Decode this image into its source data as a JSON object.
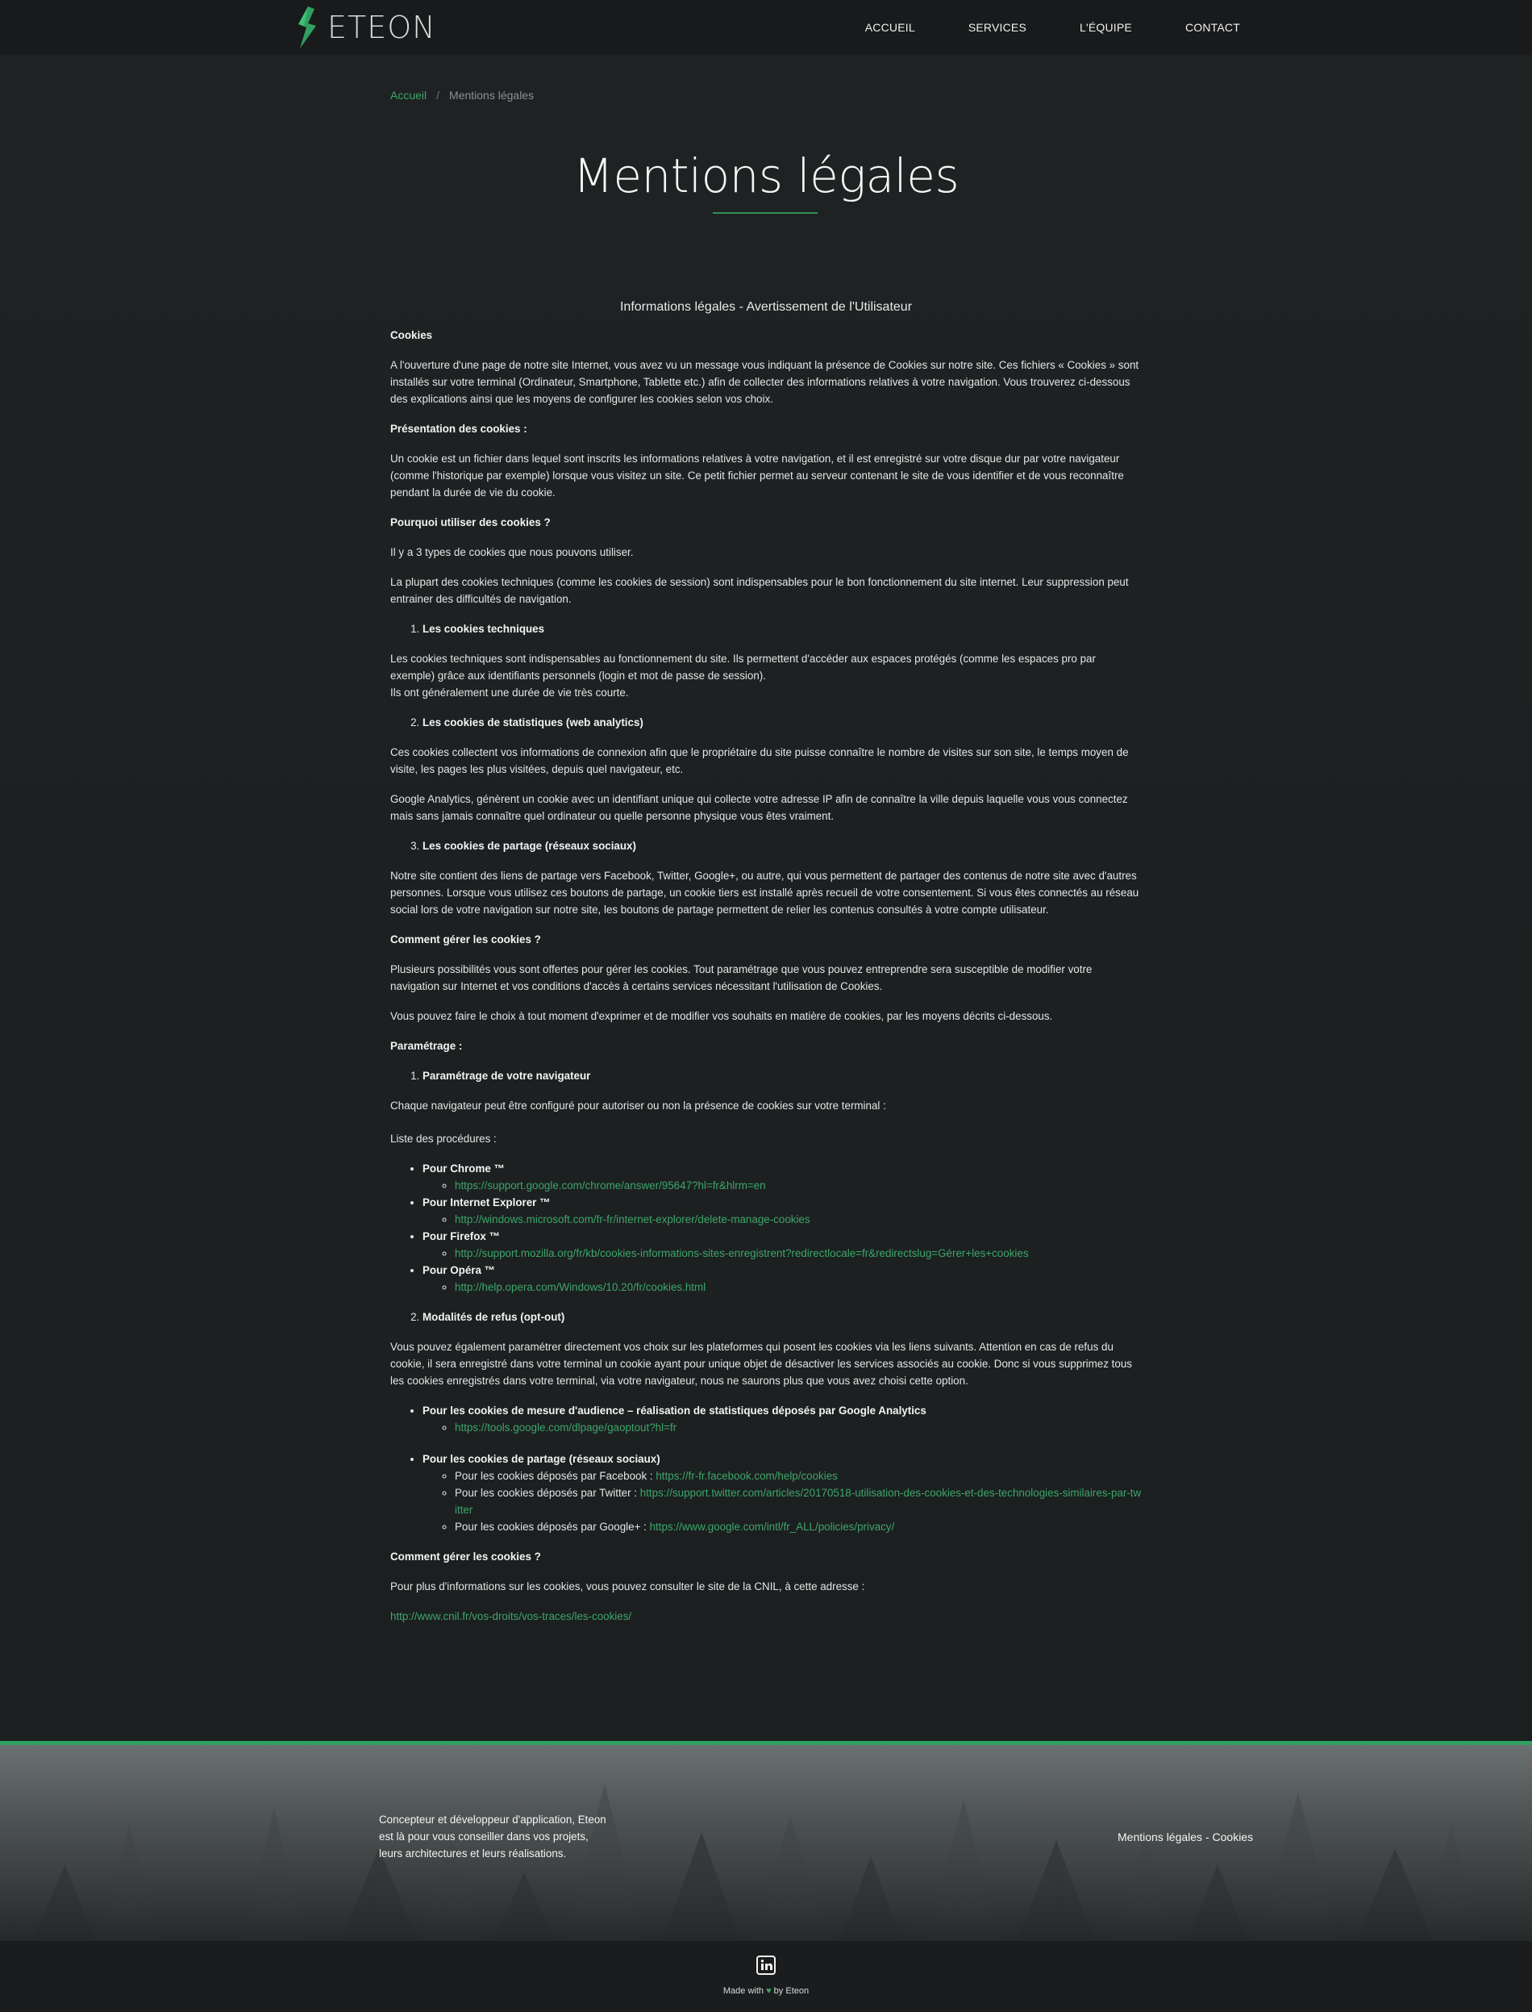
{
  "header": {
    "brand": "ETEON",
    "nav": [
      "ACCUEIL",
      "SERVICES",
      "L'ÉQUIPE",
      "CONTACT"
    ]
  },
  "breadcrumb": {
    "home": "Accueil",
    "separator": "/",
    "current": "Mentions légales"
  },
  "page": {
    "title": "Mentions légales"
  },
  "content": {
    "subtitle": "Informations légales - Avertissement de l'Utilisateur",
    "cookies_heading": "Cookies",
    "intro": "A l'ouverture d'une page de notre site Internet, vous avez vu un message vous indiquant la présence de Cookies sur notre site. Ces fichiers « Cookies » sont installés sur votre terminal (Ordinateur, Smartphone, Tablette etc.) afin de collecter des informations relatives à votre navigation. Vous trouverez ci-dessous des explications ainsi que les moyens de configurer les cookies selon vos choix.",
    "presentation_heading": "Présentation des cookies :",
    "presentation_text": "Un cookie est un fichier dans lequel sont inscrits les informations relatives à votre navigation, et il est enregistré sur votre disque dur par votre navigateur (comme l'historique par exemple) lorsque vous visitez un site. Ce petit fichier permet au serveur contenant le site de vous identifier et de vous reconnaître pendant la durée de vie du cookie.",
    "why_heading": "Pourquoi utiliser des cookies ?",
    "why_text1": "Il y a 3 types de cookies que nous pouvons utiliser.",
    "why_text2": "La plupart des cookies techniques (comme les cookies de session) sont indispensables pour le bon fonctionnement du site internet. Leur suppression peut entrainer des difficultés de navigation.",
    "type1_title": "Les cookies techniques",
    "type1_text_a": "Les cookies techniques sont indispensables au fonctionnement du site. Ils permettent d'accéder aux espaces protégés (comme les espaces pro par exemple) grâce aux identifiants personnels (login et mot de passe de session).",
    "type1_text_b": "Ils ont généralement une durée de vie très courte.",
    "type2_title": "Les cookies de statistiques (web analytics)",
    "type2_text1": "Ces cookies collectent vos informations de connexion afin que le propriétaire du site puisse connaître le nombre de visites sur son site, le temps moyen de visite, les pages les plus visitées, depuis quel navigateur, etc.",
    "type2_text2": "Google Analytics, génèrent un cookie avec un identifiant unique qui collecte votre adresse IP afin de connaître la ville depuis laquelle vous vous connectez mais sans jamais connaître quel ordinateur ou quelle personne physique vous êtes vraiment.",
    "type3_title": "Les cookies de partage (réseaux sociaux)",
    "type3_text": "Notre site contient des liens de partage vers Facebook, Twitter, Google+, ou autre, qui vous permettent de partager des contenus de notre site avec d'autres personnes. Lorsque vous utilisez ces boutons de partage, un cookie tiers est installé après recueil de votre consentement. Si vous êtes connectés au réseau social lors de votre navigation sur notre site, les boutons de partage permettent de relier les contenus consultés à votre compte utilisateur.",
    "manage_heading": "Comment gérer les cookies ?",
    "manage_text1": "Plusieurs possibilités vous sont offertes pour gérer les cookies. Tout paramétrage que vous pouvez entreprendre sera susceptible de modifier votre navigation sur Internet et vos conditions d'accès à certains services nécessitant l'utilisation de Cookies.",
    "manage_text2": "Vous pouvez faire le choix à tout moment d'exprimer et de modifier vos souhaits en matière de cookies, par les moyens décrits ci-dessous.",
    "settings_heading": "Paramétrage :",
    "browser_title": "Paramétrage de votre navigateur",
    "browser_text": "Chaque navigateur peut être configuré pour autoriser ou non la présence de cookies sur votre terminal :",
    "procedures_label": "Liste des procédures :",
    "browsers": [
      {
        "name": "Pour Chrome ™",
        "url": "https://support.google.com/chrome/answer/95647?hl=fr&hlrm=en"
      },
      {
        "name": "Pour Internet Explorer ™",
        "url": "http://windows.microsoft.com/fr-fr/internet-explorer/delete-manage-cookies"
      },
      {
        "name": "Pour Firefox ™",
        "url": "http://support.mozilla.org/fr/kb/cookies-informations-sites-enregistrent?redirectlocale=fr&redirectslug=Gérer+les+cookies"
      },
      {
        "name": "Pour Opéra ™",
        "url": "http://help.opera.com/Windows/10.20/fr/cookies.html"
      }
    ],
    "optout_title": "Modalités de refus (opt-out)",
    "optout_text": "Vous pouvez également paramétrer directement vos choix sur les plateformes qui posent les cookies via les liens suivants. Attention en cas de refus du cookie, il sera enregistré dans votre terminal un cookie ayant pour unique objet de désactiver les services associés au cookie. Donc si vous supprimez tous les cookies enregistrés dans votre terminal, via votre navigateur, nous ne saurons plus que vous avez choisi cette option.",
    "analytics_title": "Pour les cookies de mesure d'audience – réalisation de statistiques déposés par Google Analytics",
    "analytics_url": "https://tools.google.com/dlpage/gaoptout?hl=fr",
    "social_title": "Pour les cookies de partage (réseaux sociaux)",
    "social": [
      {
        "label": "Pour les cookies déposés par Facebook : ",
        "url": "https://fr-fr.facebook.com/help/cookies"
      },
      {
        "label": "Pour les cookies déposés par Twitter : ",
        "url": "https://support.twitter.com/articles/20170518-utilisation-des-cookies-et-des-technologies-similaires-par-twitter"
      },
      {
        "label": "Pour les cookies déposés par Google+ : ",
        "url": "https://www.google.com/intl/fr_ALL/policies/privacy/"
      }
    ],
    "cnil_heading": "Comment gérer les cookies ?",
    "cnil_text": "Pour plus d'informations sur les cookies, vous pouvez consulter le site de la CNIL, à cette adresse :",
    "cnil_url": "http://www.cnil.fr/vos-droits/vos-traces/les-cookies/"
  },
  "footer": {
    "about": "Concepteur et développeur d'application, Eteon est là pour vous conseiller dans vos projets, leurs architectures et leurs réalisations.",
    "legal_link": "Mentions légales",
    "legal_sep": " - ",
    "cookies_link": "Cookies",
    "made_prefix": "Made with ",
    "heart": "♥",
    "made_suffix": " by Eteon"
  },
  "colors": {
    "accent": "#3da66a",
    "background": "#1c2021",
    "header": "#181a1b"
  },
  "icons": {
    "logo": "eteon-logo-icon",
    "social": "linkedin-icon",
    "heart": "heart-icon"
  }
}
